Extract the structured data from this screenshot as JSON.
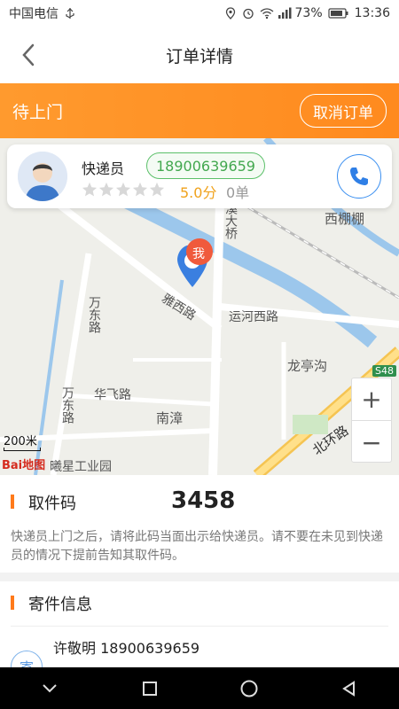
{
  "status_bar": {
    "carrier": "中国电信",
    "battery": "73%",
    "time": "13:36"
  },
  "header": {
    "title": "订单详情"
  },
  "banner": {
    "status": "待上门",
    "cancel_label": "取消订单"
  },
  "courier": {
    "role_label": "快递员",
    "phone": "18900639659",
    "rating": "5.0分",
    "orders": "0单",
    "stars_filled": 0,
    "stars_total": 5
  },
  "map": {
    "labels": {
      "bridge": "溪大桥",
      "xipengpeng": "西棚棚",
      "me": "我",
      "yaxi_road": "雅西路",
      "yunhe_road": "运河西路",
      "wandong_road_1": "万东路",
      "wandong_road_2": "万东路",
      "huafei_road": "华飞路",
      "longtinggou": "龙亭沟",
      "nanzhang": "南漳",
      "beihuan_road": "北环路",
      "s48": "S48",
      "industrial_park": "曦星工业园"
    },
    "scale": "200米",
    "logo": "Bai地图",
    "zoom_in": "+",
    "zoom_out": "−"
  },
  "pickup": {
    "heading": "取件码",
    "code": "3458",
    "description": "快递员上门之后，请将此码当面出示给快递员。请不要在未见到快递员的情况下提前告知其取件码。"
  },
  "sender": {
    "heading": "寄件信息",
    "name_phone": "许敬明 18900639659",
    "tag": "寄"
  },
  "colors": {
    "accent": "#ff8a1e",
    "green": "#43a84f",
    "blue": "#3a8ff0",
    "star_empty": "#d8d8d8",
    "rating": "#f0a21c"
  }
}
